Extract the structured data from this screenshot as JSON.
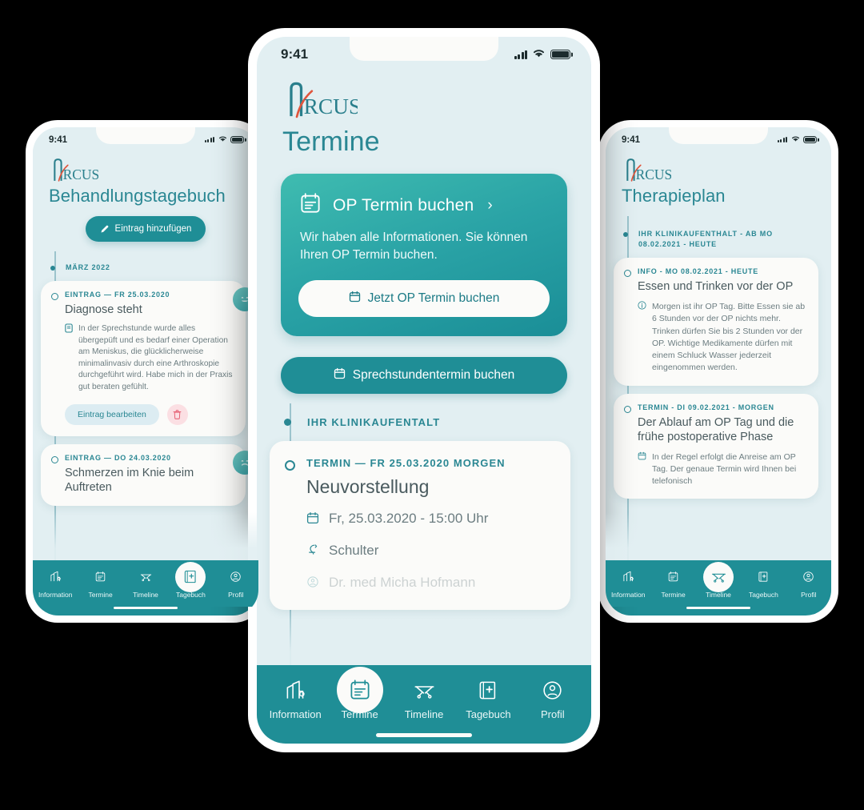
{
  "app": {
    "brand": "ARCUS",
    "accent": "#2a8793",
    "teal_dark": "#1f8e96",
    "swoosh": "#e0553c",
    "bg": "#e2eff2"
  },
  "phones": {
    "left": {
      "status": {
        "time": "9:41"
      },
      "title": "Behandlungstagebuch",
      "add_entry_label": "Eintrag hinzufügen",
      "month_label": "MÄRZ 2022",
      "entries": [
        {
          "kicker": "EINTRAG — FR 25.03.2020",
          "title": "Diagnose steht",
          "text": "In der Sprechstunde wurde alles übergepüft und es bedarf einer Operation am Meniskus, die glücklicherweise minimalinvasiv durch eine Arthroskopie durchgeführt wird. Habe mich in der Praxis gut beraten gefühlt.",
          "mood": "happy",
          "edit_label": "Eintrag bearbeiten",
          "delete_label": "Löschen"
        },
        {
          "kicker": "EINTRAG — DO 24.03.2020",
          "title": "Schmerzen im Knie beim Auftreten",
          "mood": "sad"
        }
      ],
      "nav": {
        "active": "Tagebuch",
        "items": [
          {
            "label": "Information",
            "icon": "building-icon"
          },
          {
            "label": "Termine",
            "icon": "clipboard-icon"
          },
          {
            "label": "Timeline",
            "icon": "stretcher-icon"
          },
          {
            "label": "Tagebuch",
            "icon": "book-medical-icon"
          },
          {
            "label": "Profil",
            "icon": "user-circle-icon"
          }
        ]
      }
    },
    "middle": {
      "status": {
        "time": "9:41"
      },
      "title": "Termine",
      "op_card": {
        "heading": "OP Termin buchen",
        "chevron": "›",
        "subtitle": "Wir haben alle Informationen. Sie können Ihren OP Termin buchen.",
        "cta_label": "Jetzt OP Termin buchen"
      },
      "consult_button": "Sprechstundentermin buchen",
      "timeline_section": "IHR KLINIKAUFENTALT",
      "appointment": {
        "kicker": "TERMIN — FR 25.03.2020 MORGEN",
        "title": "Neuvorstellung",
        "date": "Fr, 25.03.2020 - 15:00 Uhr",
        "bodypart": "Schulter",
        "doctor": "Dr. med Micha Hofmann"
      },
      "nav": {
        "active": "Termine",
        "items": [
          {
            "label": "Information",
            "icon": "building-icon"
          },
          {
            "label": "Termine",
            "icon": "clipboard-icon"
          },
          {
            "label": "Timeline",
            "icon": "stretcher-icon"
          },
          {
            "label": "Tagebuch",
            "icon": "book-medical-icon"
          },
          {
            "label": "Profil",
            "icon": "user-circle-icon"
          }
        ]
      }
    },
    "right": {
      "status": {
        "time": "9:41"
      },
      "title": "Therapieplan",
      "timeline_section": "IHR KLINIKAUFENTHALT - AB MO 08.02.2021 - HEUTE",
      "cards": [
        {
          "kicker": "INFO - MO 08.02.2021 - HEUTE",
          "title": "Essen und Trinken vor der OP",
          "text": "Morgen ist ihr OP Tag. Bitte Essen sie ab 6 Stunden vor der OP nichts mehr. Trinken dürfen Sie bis 2 Stunden vor der OP. Wichtige Medikamente dürfen mit einem Schluck Wasser jederzeit eingenommen werden.",
          "icon": "info-icon"
        },
        {
          "kicker": "TERMIN - DI 09.02.2021 - MORGEN",
          "title": "Der Ablauf am OP Tag und die frühe postoperative Phase",
          "text": "In der Regel erfolgt die Anreise am OP Tag. Der genaue Termin wird Ihnen bei telefonisch",
          "icon": "calendar-icon"
        }
      ],
      "nav": {
        "active": "Timeline",
        "items": [
          {
            "label": "Information",
            "icon": "building-icon"
          },
          {
            "label": "Termine",
            "icon": "clipboard-icon"
          },
          {
            "label": "Timeline",
            "icon": "stretcher-icon"
          },
          {
            "label": "Tagebuch",
            "icon": "book-medical-icon"
          },
          {
            "label": "Profil",
            "icon": "user-circle-icon"
          }
        ]
      }
    }
  }
}
